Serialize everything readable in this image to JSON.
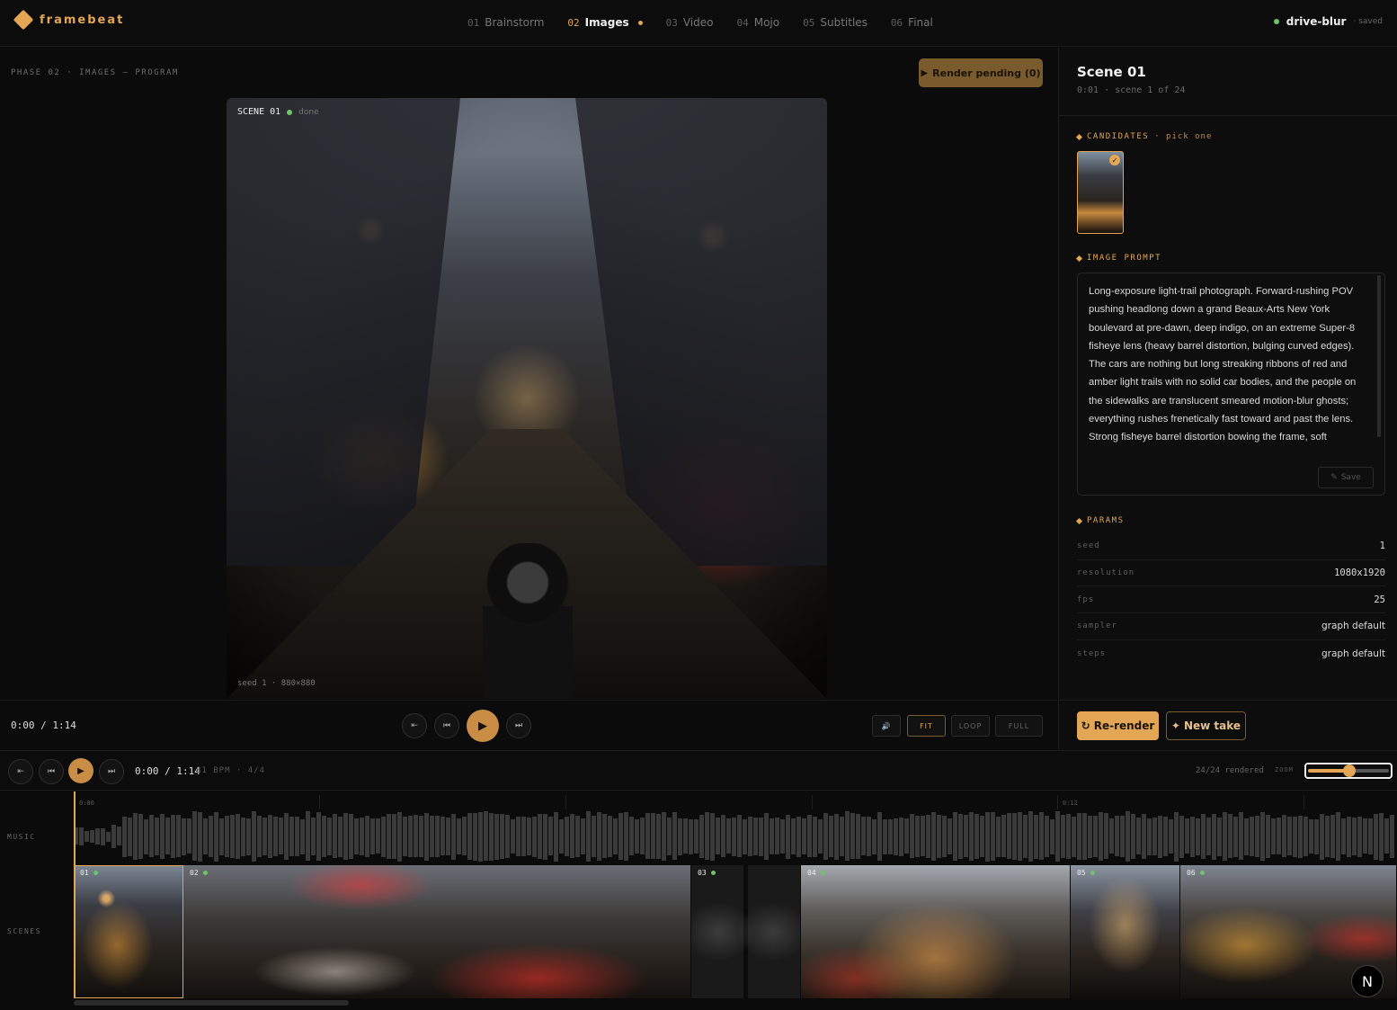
{
  "app": {
    "name": "framebeat"
  },
  "phases": [
    {
      "num": "01",
      "label": "Brainstorm",
      "active": false
    },
    {
      "num": "02",
      "label": "Images",
      "active": true
    },
    {
      "num": "03",
      "label": "Video",
      "active": false
    },
    {
      "num": "04",
      "label": "Mojo",
      "active": false
    },
    {
      "num": "05",
      "label": "Subtitles",
      "active": false
    },
    {
      "num": "06",
      "label": "Final",
      "active": false
    }
  ],
  "project": {
    "name": "drive-blur",
    "status": "· saved"
  },
  "main": {
    "caption": "PHASE 02 · IMAGES — PROGRAM",
    "render_button": "Render pending (0)",
    "viewer": {
      "scene_label": "SCENE 01",
      "status": "done",
      "meta": "seed 1 · 880×880"
    }
  },
  "transport": {
    "time": "0:00 / 1:14",
    "fit": "FIT",
    "loop": "LOOP",
    "full": "FULL"
  },
  "side": {
    "scene_title": "Scene 01",
    "scene_sub": "0:01 · scene 1 of 24",
    "candidates_heading": "CANDIDATES",
    "candidates_aside": "· pick one",
    "prompt_heading": "IMAGE PROMPT",
    "prompt_text": "Long-exposure light-trail photograph. Forward-rushing POV pushing headlong down a grand Beaux-Arts New York boulevard at pre-dawn, deep indigo, on an extreme Super-8 fisheye lens (heavy barrel distortion, bulging curved edges). The cars are nothing but long streaking ribbons of red and amber light trails with no solid car bodies, and the people on the sidewalks are translucent smeared motion-blur ghosts; everything rushes frenetically fast toward and past the lens. Strong fisheye barrel distortion bowing the frame, soft",
    "save_label": "Save",
    "params_heading": "PARAMS",
    "params": [
      {
        "key": "seed",
        "value": "1"
      },
      {
        "key": "resolution",
        "value": "1080x1920"
      },
      {
        "key": "fps",
        "value": "25"
      },
      {
        "key": "sampler",
        "value": "graph default"
      },
      {
        "key": "steps",
        "value": "graph default"
      }
    ],
    "rerender_label": "Re-render",
    "newtake_label": "New take"
  },
  "timeline": {
    "time": "0:00 / 1:14",
    "bpm": "81 BPM · 4/4",
    "rendered": "24/24 rendered",
    "zoom_label": "ZOOM",
    "zoom_level": 0.45,
    "ruler": [
      "0:00",
      "0:12"
    ],
    "lanes": {
      "music": "MUSIC",
      "scenes": "SCENES"
    },
    "clips": [
      {
        "label": "01",
        "selected": true
      },
      {
        "label": "02",
        "selected": false
      },
      {
        "label": "03",
        "selected": false
      },
      {
        "label": "04",
        "selected": false
      },
      {
        "label": "05",
        "selected": false
      },
      {
        "label": "06",
        "selected": false
      }
    ]
  },
  "colors": {
    "accent": "#e3a654",
    "ok": "#6ec46a",
    "bg": "#0b0b0b"
  },
  "badge": "N"
}
